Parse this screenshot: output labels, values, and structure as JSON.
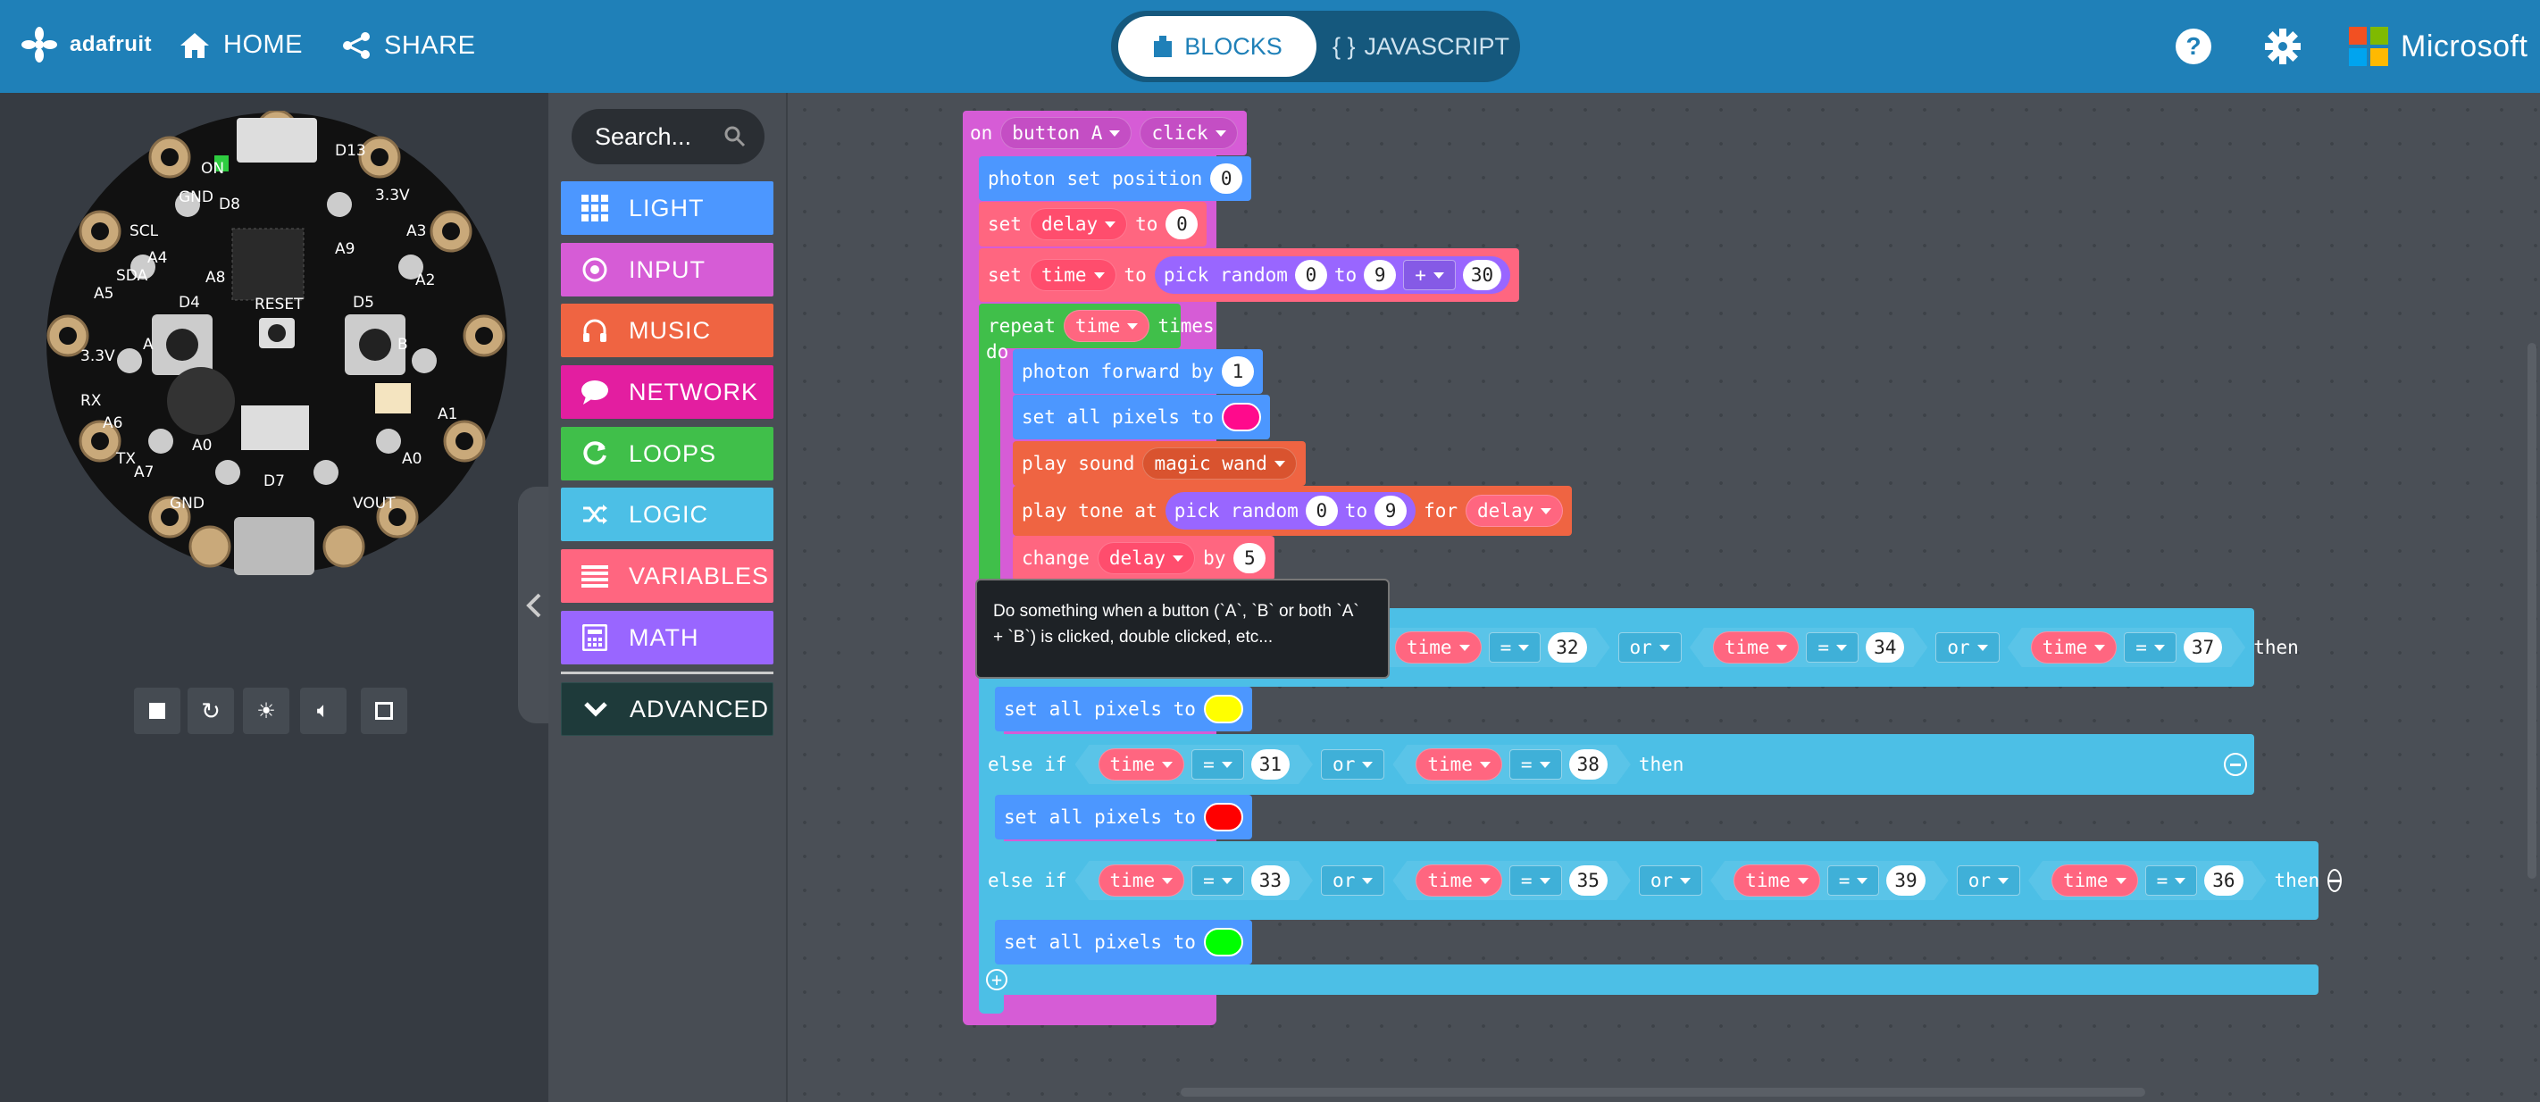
{
  "header": {
    "brand": "adafruit",
    "home": "HOME",
    "share": "SHARE",
    "tabs": [
      {
        "label": "BLOCKS",
        "active": true
      },
      {
        "label": "JAVASCRIPT",
        "active": false
      }
    ],
    "microsoft": "Microsoft",
    "help_icon": "help-icon",
    "settings_icon": "gear-icon"
  },
  "toolbox": {
    "search_placeholder": "Search...",
    "categories": [
      {
        "label": "LIGHT",
        "color": "#4c97ff",
        "icon": "grid-icon"
      },
      {
        "label": "INPUT",
        "color": "#d65cd6",
        "icon": "input-circle-icon"
      },
      {
        "label": "MUSIC",
        "color": "#ef6442",
        "icon": "headphones-icon"
      },
      {
        "label": "NETWORK",
        "color": "#e31ea0",
        "icon": "chat-icon"
      },
      {
        "label": "LOOPS",
        "color": "#40bf4a",
        "icon": "refresh-icon"
      },
      {
        "label": "LOGIC",
        "color": "#4cbfe6",
        "icon": "shuffle-icon"
      },
      {
        "label": "VARIABLES",
        "color": "#ff6680",
        "icon": "list-icon"
      },
      {
        "label": "MATH",
        "color": "#9966ff",
        "icon": "calculator-icon"
      }
    ],
    "advanced": "ADVANCED"
  },
  "simulator": {
    "labels": [
      "GND",
      "D13",
      "3.3V",
      "A3",
      "A2",
      "SCL",
      "SDA",
      "A4",
      "A5",
      "3.3V",
      "RX",
      "A6",
      "A7",
      "TX",
      "GND",
      "VOUT",
      "A1",
      "A0",
      "A8",
      "A9",
      "D4",
      "D5",
      "D7",
      "D8",
      "RESET",
      "A",
      "B",
      "ON"
    ],
    "controls": [
      "stop-icon",
      "restart-icon",
      "debug-icon",
      "sound-icon",
      "fullscreen-icon"
    ]
  },
  "tooltip": "Do something when a button (`A`, `B` or both `A` + `B`) is clicked, double clicked, etc...",
  "blocks": {
    "on": "on",
    "button": "button A",
    "event": "click",
    "photon_set": "photon set position",
    "photon_set_val": "0",
    "set": "set",
    "to": "to",
    "delay": "delay",
    "delay_val": "0",
    "time": "time",
    "pick_random": "pick random",
    "r1": "0",
    "r2": "9",
    "plus": "+",
    "r3": "30",
    "repeat": "repeat",
    "times": "times",
    "do": "do",
    "photon_forward": "photon forward by",
    "fwd_val": "1",
    "set_all_pixels": "set all pixels to",
    "play_sound": "play sound",
    "sound": "magic wand",
    "play_tone": "play tone at",
    "for": "for",
    "change": "change",
    "by": "by",
    "change_val": "5",
    "if_vals": [
      "32",
      "34",
      "37"
    ],
    "or": "or",
    "eq": "=",
    "then": "then",
    "else_if": "else if",
    "elif1_vals": [
      "31",
      "38"
    ],
    "elif2_vals": [
      "33",
      "35",
      "39",
      "36"
    ],
    "colors": {
      "pink": "#ff0a8c",
      "yellow": "#ffff00",
      "red": "#ff0000",
      "green": "#00ff00"
    }
  }
}
